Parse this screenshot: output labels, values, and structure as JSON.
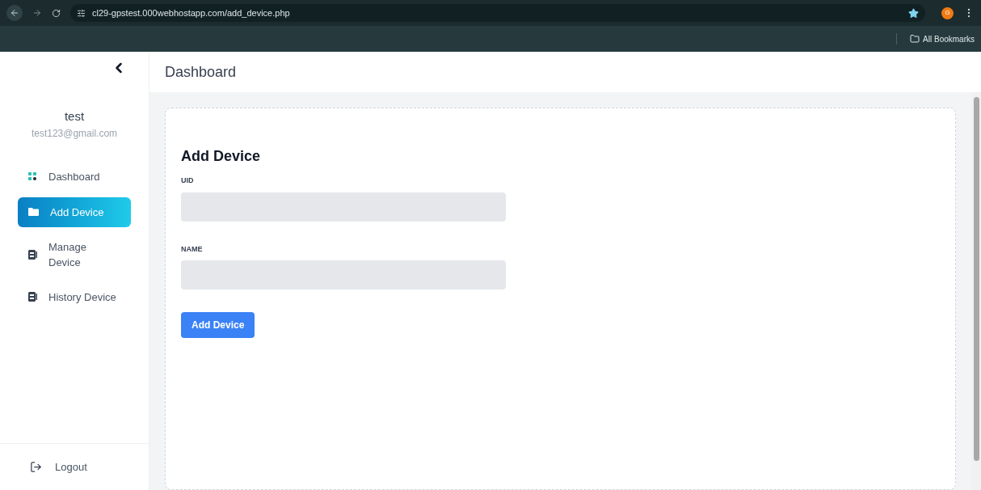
{
  "browser": {
    "url": "cl29-gpstest.000webhostapp.com/add_device.php",
    "avatar_letter": "G",
    "bookmarks_label": "All Bookmarks"
  },
  "sidebar": {
    "user_name": "test",
    "user_email": "test123@gmail.com",
    "items": [
      {
        "label": "Dashboard",
        "kind": "dashboard",
        "selected": false
      },
      {
        "label": "Add Device",
        "kind": "folder",
        "selected": true
      },
      {
        "label": "Manage\nDevice",
        "kind": "book",
        "selected": false
      },
      {
        "label": "History Device",
        "kind": "book",
        "selected": false
      }
    ],
    "logout": "Logout"
  },
  "header": {
    "title": "Dashboard"
  },
  "form": {
    "title": "Add Device",
    "fields": [
      {
        "label": "UID"
      },
      {
        "label": "NAME"
      }
    ],
    "submit": "Add Device"
  }
}
